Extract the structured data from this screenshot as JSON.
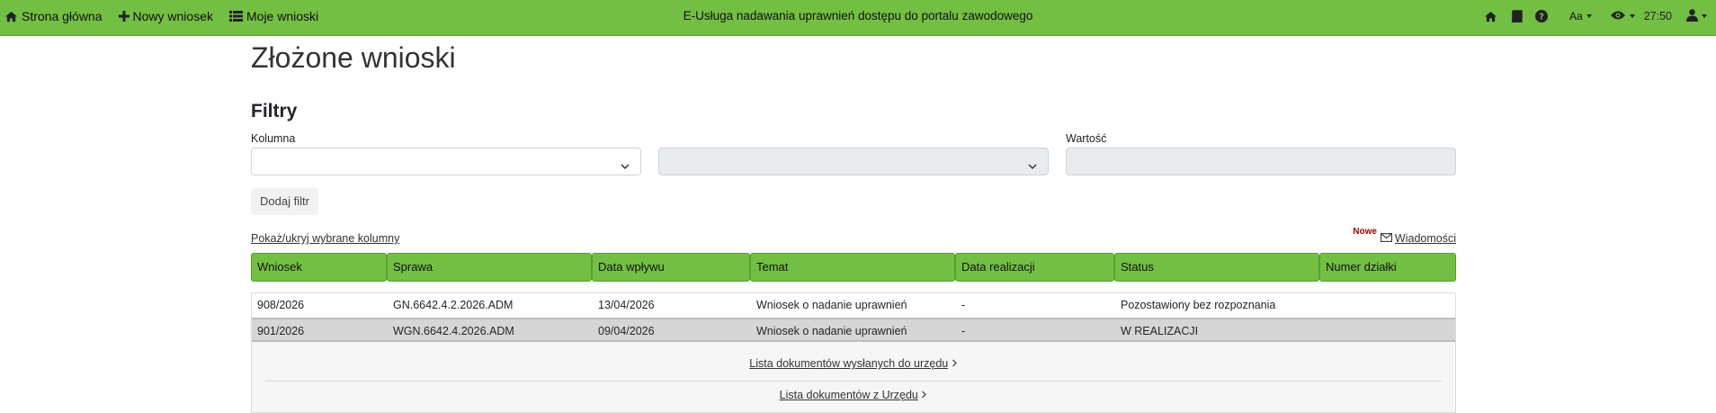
{
  "nav": {
    "home_label": "Strona główna",
    "new_label": "Nowy wniosek",
    "mine_label": "Moje wnioski",
    "app_title": "E-Usługa nadawania uprawnień dostępu do portalu zawodowego",
    "font_size_label": "Aa",
    "clock": "27:50"
  },
  "page": {
    "title": "Złożone wnioski"
  },
  "filters": {
    "title": "Filtry",
    "column_label": "Kolumna",
    "value_label": "Wartość",
    "column_value": "",
    "operator_value": "",
    "value_value": "",
    "add_button": "Dodaj filtr"
  },
  "toolbar": {
    "toggle_columns": "Pokaż/ukryj wybrane kolumny",
    "new_badge": "Nowe",
    "messages": "Wiadomości"
  },
  "table": {
    "headers": [
      "Wniosek",
      "Sprawa",
      "Data wpływu",
      "Temat",
      "Data realizacji",
      "Status",
      "Numer działki"
    ],
    "rows": [
      [
        "908/2026",
        "GN.6642.4.2.2026.ADM",
        "13/04/2026",
        "Wniosek o nadanie uprawnień",
        "-",
        "Pozostawiony bez rozpoznania",
        ""
      ],
      [
        "901/2026",
        "WGN.6642.4.2026.ADM",
        "09/04/2026",
        "Wniosek o nadanie uprawnień",
        "-",
        "W REALIZACJI",
        ""
      ]
    ],
    "details": {
      "sent_docs": "Lista dokumentów wysłanych do urzędu",
      "office_docs": "Lista dokumentów z Urzędu"
    }
  },
  "colors": {
    "brand_green": "#72bf44",
    "selected_row": "#d6d6d6"
  }
}
